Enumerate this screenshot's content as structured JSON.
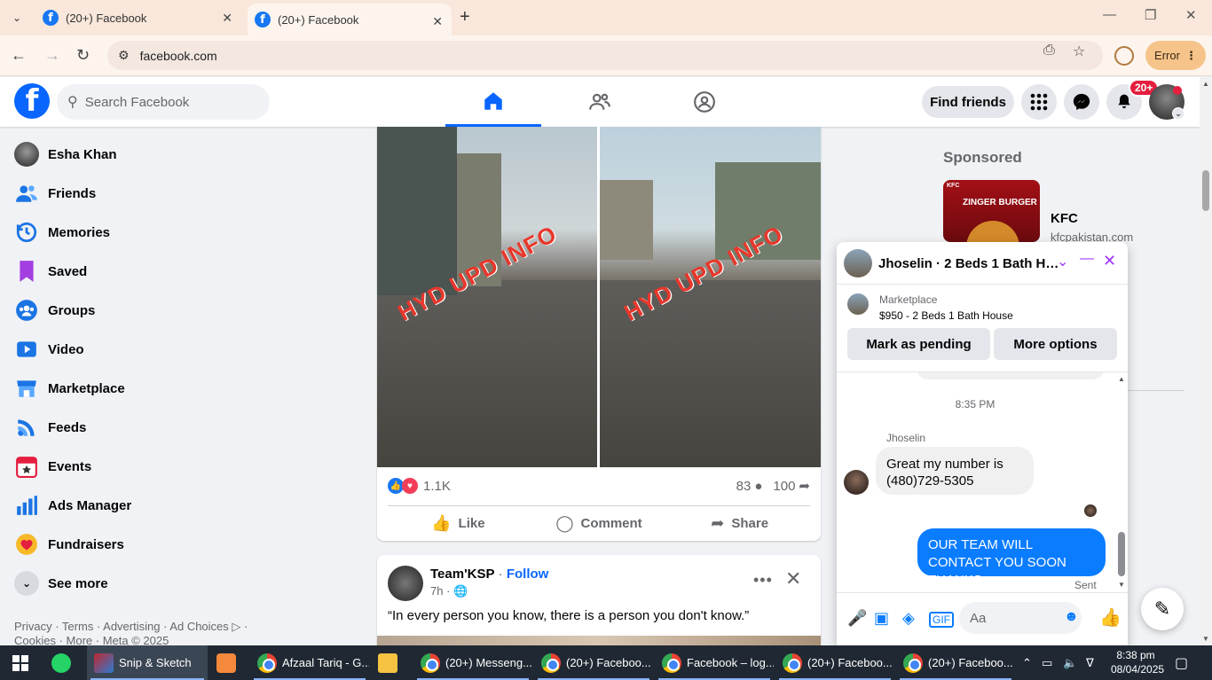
{
  "browser": {
    "tabs": [
      {
        "title": "(20+) Facebook",
        "active": false
      },
      {
        "title": "(20+) Facebook",
        "active": true
      }
    ],
    "url": "facebook.com",
    "error_label": "Error"
  },
  "header": {
    "search_placeholder": "Search Facebook",
    "find_friends": "Find friends",
    "notification_badge": "20+"
  },
  "sidebar": {
    "items": [
      {
        "label": "Esha Khan",
        "icon": "profile-avatar"
      },
      {
        "label": "Friends",
        "icon": "friends-icon"
      },
      {
        "label": "Memories",
        "icon": "memories-icon"
      },
      {
        "label": "Saved",
        "icon": "saved-icon"
      },
      {
        "label": "Groups",
        "icon": "groups-icon"
      },
      {
        "label": "Video",
        "icon": "video-icon"
      },
      {
        "label": "Marketplace",
        "icon": "marketplace-icon"
      },
      {
        "label": "Feeds",
        "icon": "feeds-icon"
      },
      {
        "label": "Events",
        "icon": "events-icon"
      },
      {
        "label": "Ads Manager",
        "icon": "ads-manager-icon"
      },
      {
        "label": "Fundraisers",
        "icon": "fundraisers-icon"
      },
      {
        "label": "See more",
        "icon": "chevron-down-icon"
      }
    ],
    "footer_line1": "Privacy · Terms · Advertising · Ad Choices ▷ ·",
    "footer_line2": "Cookies · More · Meta © 2025"
  },
  "post": {
    "watermark": "HYD UPD INFO",
    "reaction_count": "1.1K",
    "comment_count": "83",
    "share_count": "100",
    "like_label": "Like",
    "comment_label": "Comment",
    "share_label": "Share"
  },
  "post2": {
    "author": "Team'KSP",
    "follow": "Follow",
    "time": "7h",
    "text": "“In every person you know, there is a person you don't know.”"
  },
  "sponsored": {
    "heading": "Sponsored",
    "ad_brand": "KFC",
    "ad_url": "kfcpakistan.com",
    "ad_image_text_top": "KFC",
    "ad_image_text": "ZINGER BURGER"
  },
  "chat": {
    "title": "Jhoselin · 2 Beds 1 Bath Ho...",
    "marketplace_label": "Marketplace",
    "listing": "$950 - 2 Beds 1 Bath House",
    "mark_pending": "Mark as pending",
    "more_options": "More options",
    "timestamp": "8:35 PM",
    "sender": "Jhoselin",
    "incoming_line1": "Great my number is",
    "incoming_line2": "(480)729-5305",
    "outgoing": "OUR TEAM WILL CONTACT YOU SOON THANKS",
    "sent_label": "Sent",
    "input_placeholder": "Aa"
  },
  "taskbar": {
    "apps": [
      {
        "label": "Snip & Sketch",
        "active": true
      },
      {
        "label": "Afzaal Tariq - G..."
      },
      {
        "label": "(20+) Messeng..."
      },
      {
        "label": "(20+) Faceboo..."
      },
      {
        "label": "Facebook – log..."
      },
      {
        "label": "(20+) Faceboo..."
      },
      {
        "label": "(20+) Faceboo..."
      }
    ],
    "time": "8:38 pm",
    "date": "08/04/2025"
  },
  "colors": {
    "fb_blue": "#0866ff",
    "messenger_blue": "#0a7cff",
    "badge_red": "#e41e3f",
    "chrome_frame": "#f8e7da"
  }
}
